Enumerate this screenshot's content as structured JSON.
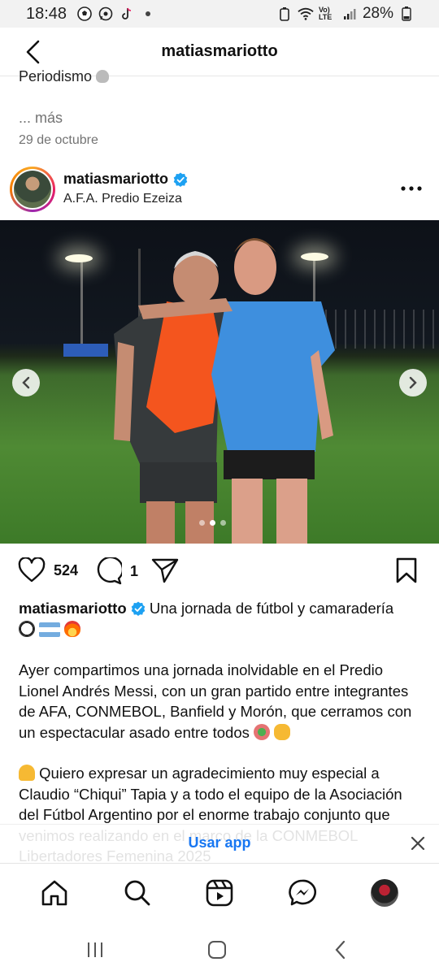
{
  "status": {
    "time": "18:48",
    "network": "Vo) LTE",
    "battery": "28%"
  },
  "header": {
    "title": "matiasmariotto"
  },
  "previous_post": {
    "caption_tail": "Periodismo",
    "more": "... más",
    "date": "29 de octubre"
  },
  "post": {
    "username": "matiasmariotto",
    "location": "A.F.A. Predio Ezeiza",
    "likes": "524",
    "comments": "1",
    "carousel": {
      "count": 3,
      "active_index": 1
    },
    "caption": {
      "username": "matiasmariotto",
      "headline": "Una jornada de fútbol y camaradería",
      "p1": "Ayer compartimos una jornada inolvidable en el Predio Lionel Andrés Messi, con un gran partido entre integrantes de AFA, CONMEBOL, Banfield y Morón, que cerramos con un espectacular asado entre todos",
      "p2": "Quiero expresar un agradecimiento muy especial a Claudio “Chiqui” Tapia y a todo el equipo de la Asociación del Fútbol Argentino por el enorme trabajo conjunto que venimos realizando en el marco de la CONMEBOL Libertadores Femenina 2025"
    }
  },
  "banner": {
    "label": "Usar app"
  },
  "colors": {
    "link_blue": "#1877f2",
    "verified_blue": "#1da1f2"
  }
}
